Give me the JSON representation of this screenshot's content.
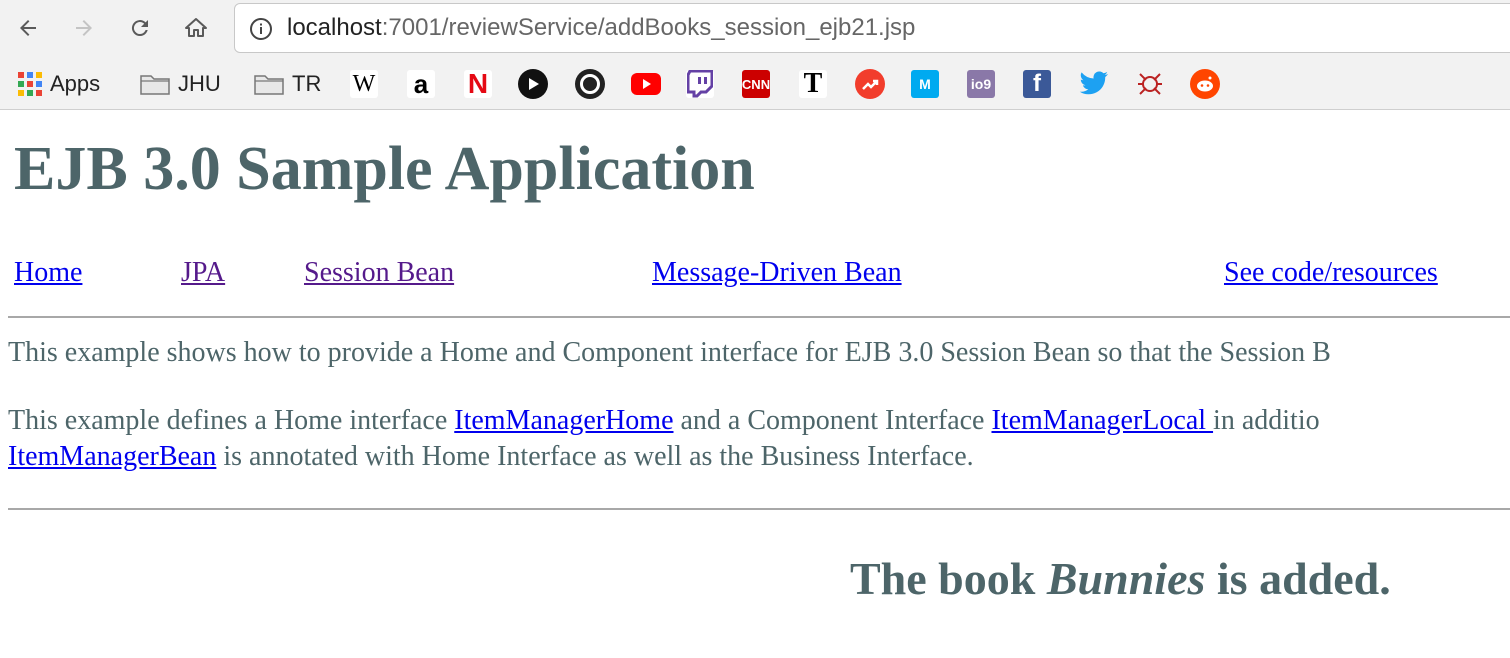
{
  "browser": {
    "url_host": "localhost",
    "url_path": ":7001/reviewService/addBooks_session_ejb21.jsp",
    "bookmarks": {
      "apps": "Apps",
      "jhu": "JHU",
      "tr": "TR"
    },
    "bookmark_icons": [
      "wikipedia-icon",
      "amazon-icon",
      "netflix-icon",
      "play-icon",
      "circle-icon",
      "youtube-icon",
      "twitch-icon",
      "cnn-icon",
      "nytimes-icon",
      "trending-icon",
      "medium-icon",
      "io9-icon",
      "facebook-icon",
      "twitter-icon",
      "bug-icon",
      "reddit-icon"
    ]
  },
  "page": {
    "title": "EJB 3.0 Sample Application",
    "nav": {
      "home": "Home",
      "jpa": "JPA",
      "session_bean": "Session Bean",
      "mdb": "Message-Driven Bean",
      "code": "See code/resources"
    },
    "para1": "This example shows how to provide a Home and Component interface for EJB 3.0 Session Bean so that the Session B",
    "para2": {
      "t1": "This example defines a Home interface ",
      "link1": "ItemManagerHome",
      "t2": " and a Component Interface ",
      "link2": "ItemManagerLocal ",
      "t3": "in additio",
      "link3": "ItemManagerBean",
      "t4": " is annotated with Home Interface as well as the Business Interface."
    },
    "result": {
      "prefix": "The book ",
      "book": "Bunnies",
      "suffix": " is added."
    }
  },
  "colors": {
    "heading": "#4d6569",
    "link": "#0000ee",
    "visited": "#551a8b"
  }
}
